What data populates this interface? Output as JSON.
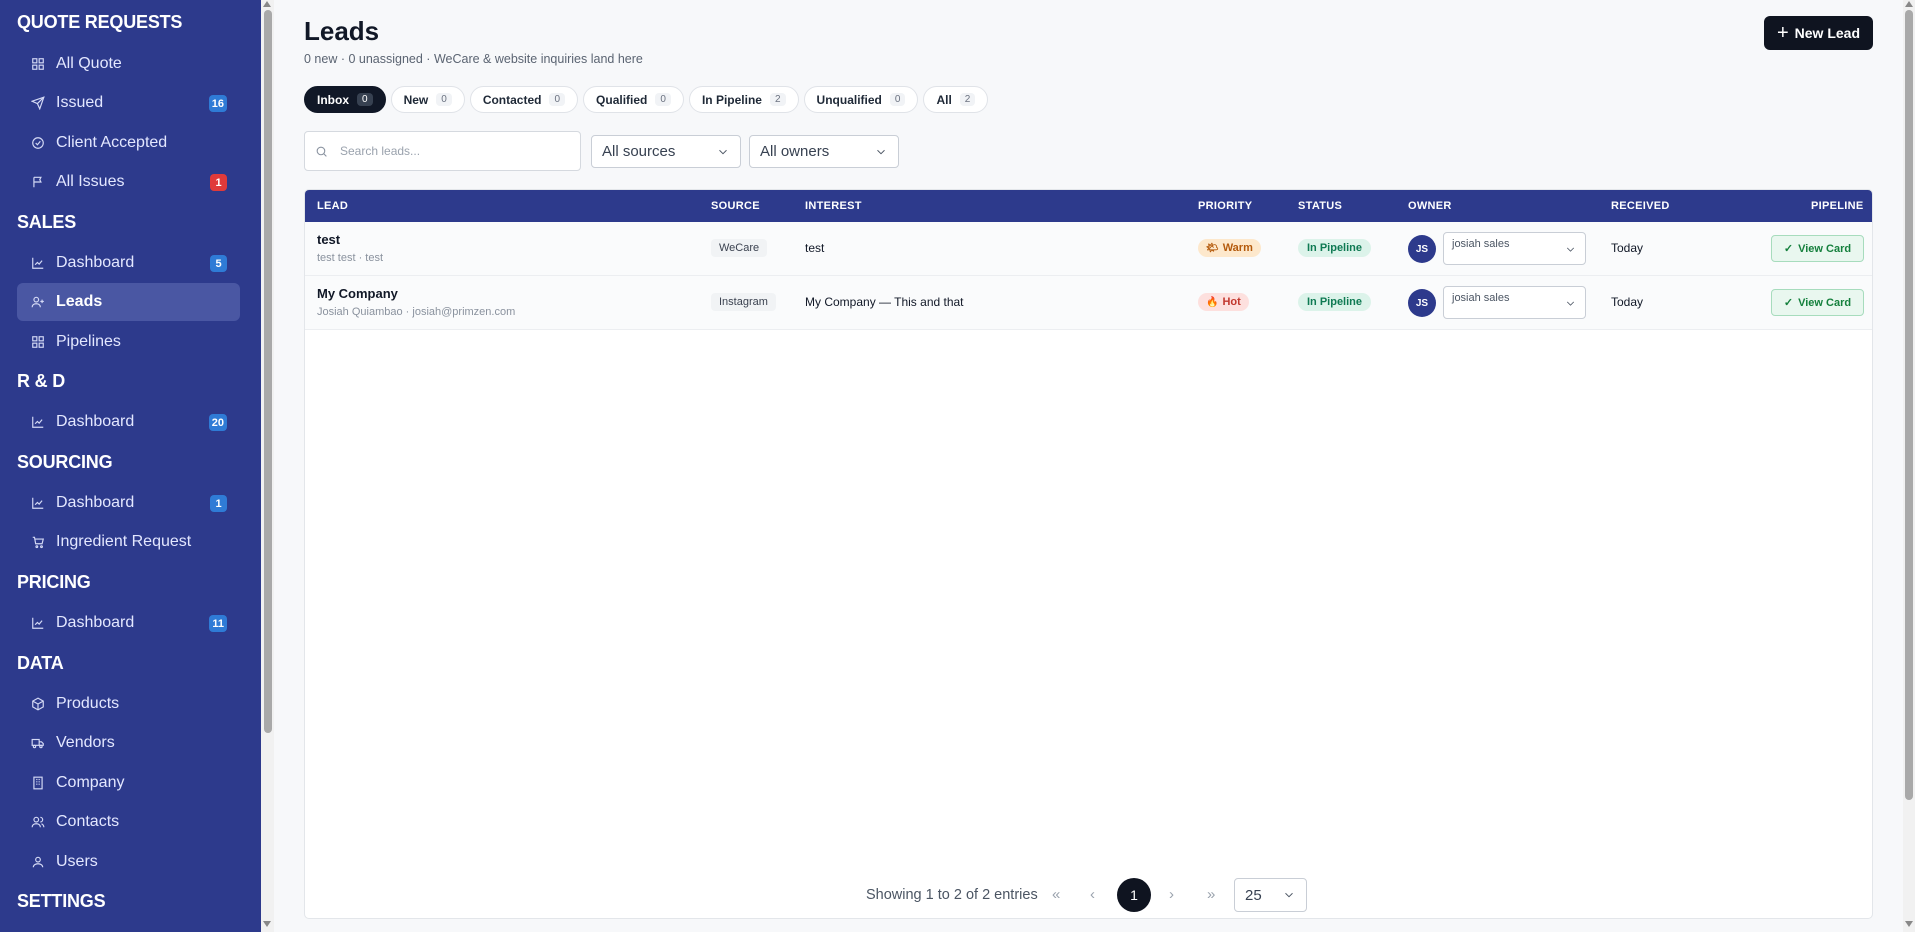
{
  "sidebar": {
    "sections": {
      "quote_requests": "QUOTE REQUESTS",
      "sales": "SALES",
      "rnd": "R & D",
      "sourcing": "SOURCING",
      "pricing": "PRICING",
      "data": "DATA",
      "settings": "SETTINGS"
    },
    "items": {
      "all_quote": {
        "label": "All Quote",
        "icon": "grid-icon"
      },
      "issued": {
        "label": "Issued",
        "icon": "send-icon",
        "badge": "16"
      },
      "client_accepted": {
        "label": "Client Accepted",
        "icon": "check-circle-icon"
      },
      "all_issues": {
        "label": "All Issues",
        "icon": "flag-icon",
        "badge": "1"
      },
      "sales_dashboard": {
        "label": "Dashboard",
        "icon": "chart-icon",
        "badge": "5"
      },
      "leads": {
        "label": "Leads",
        "icon": "user-plus-icon"
      },
      "pipelines": {
        "label": "Pipelines",
        "icon": "grid-icon"
      },
      "rnd_dashboard": {
        "label": "Dashboard",
        "icon": "chart-icon",
        "badge": "20"
      },
      "sourcing_dashboard": {
        "label": "Dashboard",
        "icon": "chart-icon",
        "badge": "1"
      },
      "ingredient_request": {
        "label": "Ingredient Request",
        "icon": "cart-icon"
      },
      "pricing_dashboard": {
        "label": "Dashboard",
        "icon": "chart-icon",
        "badge": "11"
      },
      "products": {
        "label": "Products",
        "icon": "box-icon"
      },
      "vendors": {
        "label": "Vendors",
        "icon": "truck-icon"
      },
      "company": {
        "label": "Company",
        "icon": "building-icon"
      },
      "contacts": {
        "label": "Contacts",
        "icon": "users-icon"
      },
      "users": {
        "label": "Users",
        "icon": "user-icon"
      }
    }
  },
  "header": {
    "title": "Leads",
    "subtitle": "0 new · 0 unassigned · WeCare & website inquiries land here",
    "new_lead_label": "New Lead"
  },
  "tabs": [
    {
      "label": "Inbox",
      "count": "0"
    },
    {
      "label": "New",
      "count": "0"
    },
    {
      "label": "Contacted",
      "count": "0"
    },
    {
      "label": "Qualified",
      "count": "0"
    },
    {
      "label": "In Pipeline",
      "count": "2"
    },
    {
      "label": "Unqualified",
      "count": "0"
    },
    {
      "label": "All",
      "count": "2"
    }
  ],
  "filters": {
    "search_placeholder": "Search leads...",
    "source_value": "All sources",
    "owner_value": "All owners"
  },
  "table": {
    "headers": {
      "lead": "LEAD",
      "source": "SOURCE",
      "interest": "INTEREST",
      "priority": "PRIORITY",
      "status": "STATUS",
      "owner": "OWNER",
      "received": "RECEIVED",
      "pipeline": "PIPELINE"
    },
    "rows": [
      {
        "name": "test",
        "sub": "test test · test",
        "source": "WeCare",
        "interest": "test",
        "priority": "Warm",
        "priority_icon": "🌤",
        "status": "In Pipeline",
        "owner_initials": "JS",
        "owner": "josiah sales",
        "received": "Today",
        "action": "View Card"
      },
      {
        "name": "My Company",
        "sub": "Josiah Quiambao · josiah@primzen.com",
        "source": "Instagram",
        "interest": "My Company — This and that",
        "priority": "Hot",
        "priority_icon": "🔥",
        "status": "In Pipeline",
        "owner_initials": "JS",
        "owner": "josiah sales",
        "received": "Today",
        "action": "View Card"
      }
    ]
  },
  "pagination": {
    "info": "Showing 1 to 2 of 2 entries",
    "first": "«",
    "prev": "‹",
    "current": "1",
    "next": "›",
    "last": "»",
    "page_size": "25"
  },
  "colors": {
    "sidebar_bg": "#2d3a8c",
    "header_bg": "#2d3a8c",
    "primary_button": "#0f1420",
    "badge_blue": "#2f7bd6",
    "badge_red": "#e03a3a"
  }
}
